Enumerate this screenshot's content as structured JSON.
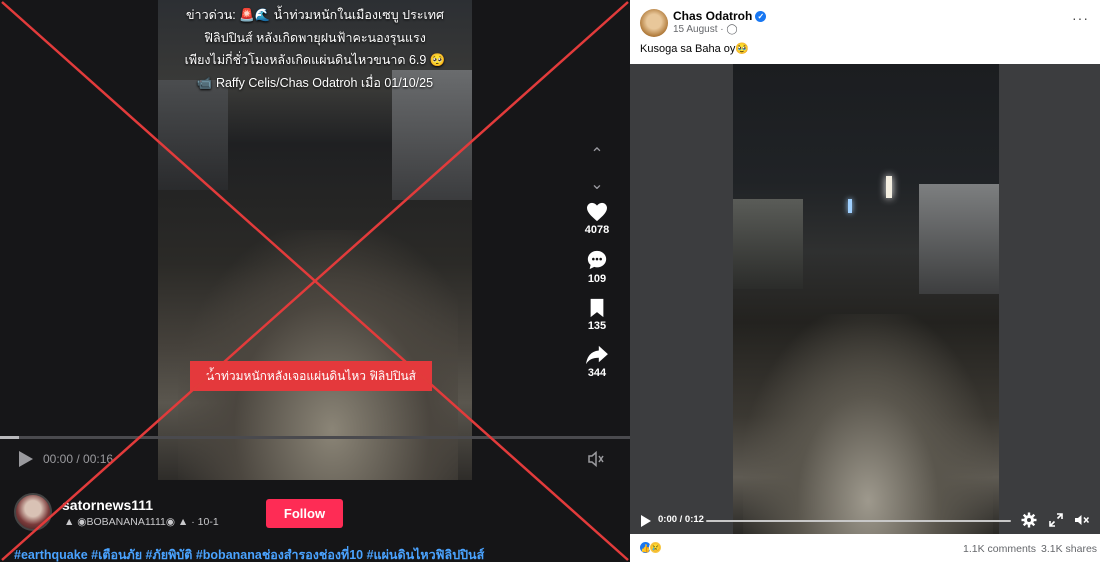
{
  "tiktok": {
    "caption_lines": [
      "ข่าวด่วน: 🚨🌊 น้ำท่วมหนักในเมืองเซบู ประเทศ",
      "ฟิลิปปินส์ หลังเกิดพายุฝนฟ้าคะนองรุนแรง",
      "เพียงไม่กี่ชั่วโมงหลังเกิดแผ่นดินไหวขนาด 6.9 🥺",
      "📹 Raffy Celis/Chas Odatroh เมื่อ 01/10/25"
    ],
    "banner_text": "น้ำท่วมหนักหลังเจอแผ่นดินไหว ฟิลิปปินส์",
    "actions": {
      "likes": "4078",
      "comments": "109",
      "saves": "135",
      "shares": "344"
    },
    "player": {
      "time": "00:00 / 00:16",
      "progress": 0.03
    },
    "user": {
      "name": "satornews111",
      "subline": "▲ ◉BOBANANA1111◉ ▲ · 10-1"
    },
    "follow_label": "Follow",
    "hashtags": "#earthquake #เตือนภัย #ภัยพิบัติ #bobananaช่องสำรองช่องที่10 #แผ่นดินไหวฟิลิปปินส์",
    "colors": {
      "follow": "#fe2c55",
      "banner": "#e4393c",
      "hashtag": "#4aa3ff",
      "cross": "#e23b3b"
    }
  },
  "facebook": {
    "author": "Chas Odatroh",
    "date": "15 August · ",
    "more": "···",
    "caption": "Kusoga sa Baha oy🥹",
    "player": {
      "time": "0:00 / 0:12",
      "progress": 0.0
    },
    "reactions": {
      "like": "👍",
      "sad": "😢"
    },
    "comments": "1.1K comments",
    "shares": "3.1K shares",
    "colors": {
      "verified": "#1877f2"
    }
  }
}
